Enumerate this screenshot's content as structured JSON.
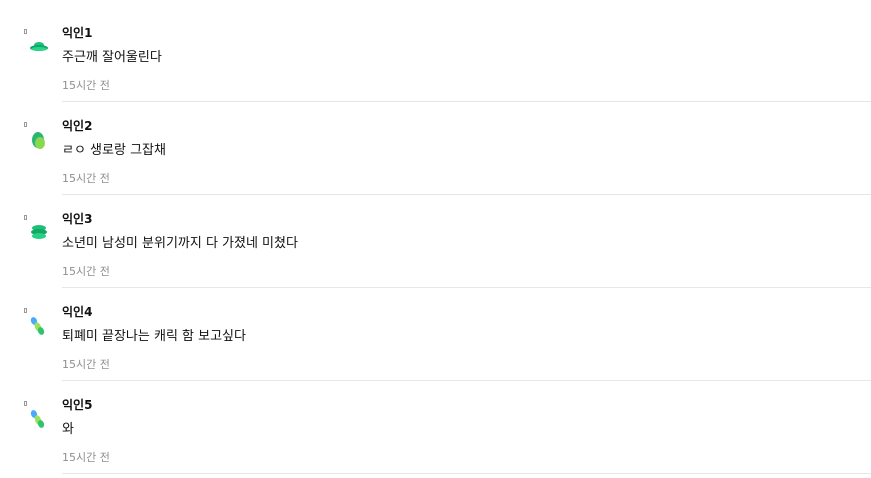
{
  "comments": [
    {
      "author": "익인1",
      "text": "주근깨 잘어울린다",
      "time": "15시간 전",
      "avatar_icon": "green-hat-avatar-icon",
      "avatar_colors": [
        "#19c37d",
        "#0aa86a"
      ]
    },
    {
      "author": "익인2",
      "text": "ㄹㅇ 생로랑 그잡채",
      "time": "15시간 전",
      "avatar_icon": "green-leaf-avatar-icon",
      "avatar_colors": [
        "#2bb673",
        "#8ad84f"
      ]
    },
    {
      "author": "익인3",
      "text": "소년미 남성미 분위기까지 다 가졌네 미쳤다",
      "time": "15시간 전",
      "avatar_icon": "green-stack-avatar-icon",
      "avatar_colors": [
        "#1fbf78",
        "#11a865"
      ]
    },
    {
      "author": "익인4",
      "text": "퇴폐미 끝장나는 캐릭 함 보고싶다",
      "time": "15시간 전",
      "avatar_icon": "blue-green-beads-avatar-icon",
      "avatar_colors": [
        "#4aa9ff",
        "#33c36d",
        "#9be15d"
      ]
    },
    {
      "author": "익인5",
      "text": "와",
      "time": "15시간 전",
      "avatar_icon": "blue-green-beads-avatar-icon",
      "avatar_colors": [
        "#4aa9ff",
        "#33c36d",
        "#9be15d"
      ]
    }
  ]
}
